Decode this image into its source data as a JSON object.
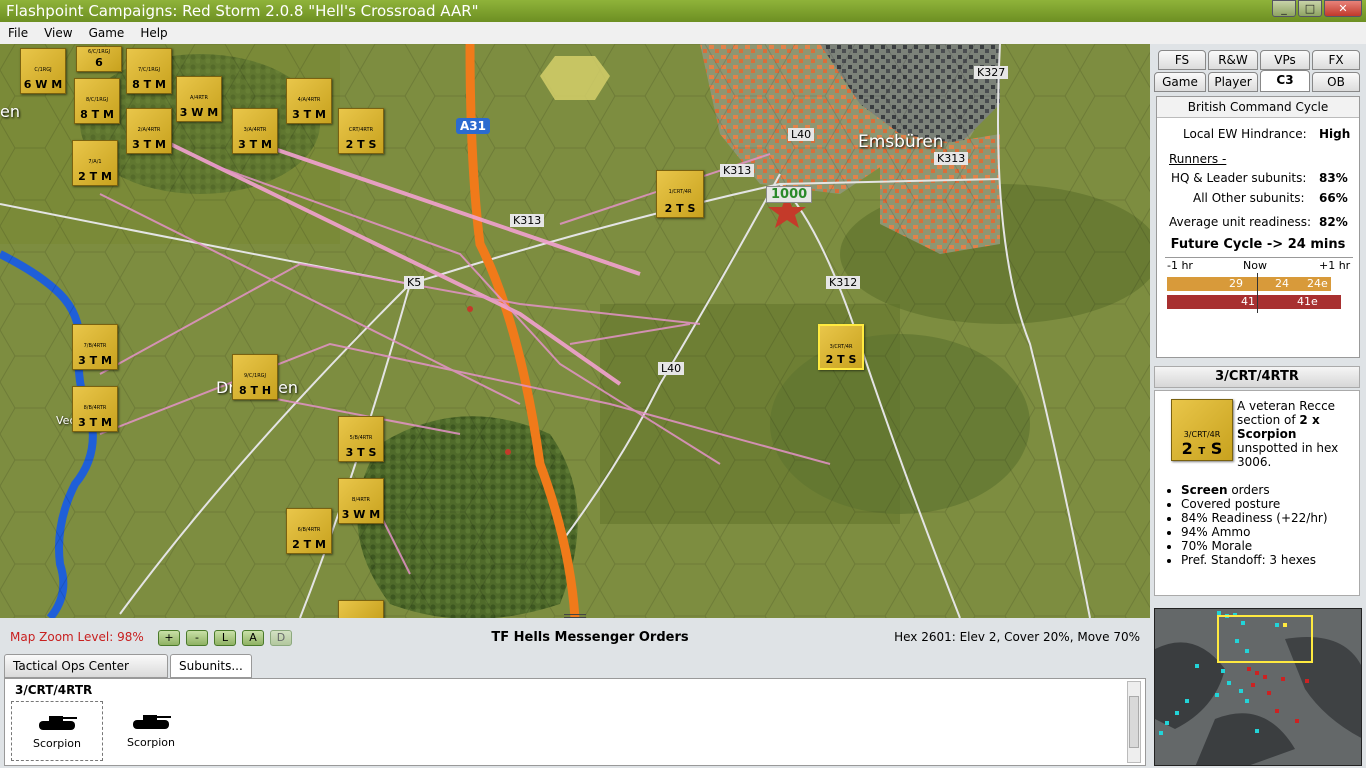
{
  "window": {
    "title": "Flashpoint Campaigns: Red Storm  2.0.8  \"Hell's Crossroad AAR\"",
    "min": "_",
    "max": "□",
    "close": "✕"
  },
  "menu": [
    "File",
    "View",
    "Game",
    "Help"
  ],
  "map": {
    "towns": [
      "Emsbüren",
      "Dr",
      "en",
      "en",
      "Vec"
    ],
    "roads": [
      "A31",
      "K327",
      "L40",
      "K313",
      "K313",
      "K313",
      "K5",
      "K312",
      "L40"
    ],
    "objective": "1000",
    "units": [
      {
        "id": "C/1RGJ",
        "str": "6",
        "t": "W",
        "s": "M"
      },
      {
        "id": "6/C/1RGJ",
        "str": "6",
        "t": "",
        "s": ""
      },
      {
        "id": "7/C/1RGJ",
        "str": "8",
        "t": "T",
        "s": "M"
      },
      {
        "id": "8/C/1RGJ",
        "str": "8",
        "t": "T",
        "s": "M"
      },
      {
        "id": "A/4RTR",
        "str": "3",
        "t": "W",
        "s": "M"
      },
      {
        "id": "4/A/4RTR",
        "str": "3",
        "t": "T",
        "s": "M"
      },
      {
        "id": "2/A/4RTR",
        "str": "3",
        "t": "T",
        "s": "M"
      },
      {
        "id": "3/A/4RTR",
        "str": "3",
        "t": "T",
        "s": "M"
      },
      {
        "id": "CRT/4RTR",
        "str": "2",
        "t": "T",
        "s": "S"
      },
      {
        "id": "7/A/1",
        "str": "2",
        "t": "T",
        "s": "M"
      },
      {
        "id": "1/CRT/4R",
        "str": "2",
        "t": "T",
        "s": "S"
      },
      {
        "id": "3/CRT/4R",
        "str": "2",
        "t": "T",
        "s": "S"
      },
      {
        "id": "7/B/4RTR",
        "str": "3",
        "t": "T",
        "s": "M"
      },
      {
        "id": "8/B/4RTR",
        "str": "3",
        "t": "T",
        "s": "M"
      },
      {
        "id": "9/C/1RGJ",
        "str": "8",
        "t": "T",
        "s": "H"
      },
      {
        "id": "5/B/4RTR",
        "str": "3",
        "t": "T",
        "s": "S"
      },
      {
        "id": "B/4RTR",
        "str": "3",
        "t": "W",
        "s": "M"
      },
      {
        "id": "6/B/4RTR",
        "str": "2",
        "t": "T",
        "s": "M"
      }
    ]
  },
  "tabs": {
    "row1": [
      "FS",
      "R&W",
      "VPs",
      "FX"
    ],
    "row2": [
      "Game",
      "Player",
      "C3",
      "OB"
    ],
    "active": "C3"
  },
  "c3": {
    "header": "British Command Cycle",
    "ew_label": "Local EW Hindrance:",
    "ew_value": "High",
    "runners": "Runners -",
    "hq_label": "HQ & Leader subunits:",
    "hq_value": "83%",
    "other_label": "All Other subunits:",
    "other_value": "66%",
    "ready_label": "Average unit readiness:",
    "ready_value": "82%",
    "future": "Future Cycle -> 24 mins",
    "t_minus": "-1 hr",
    "t_now": "Now",
    "t_plus": "+1 hr",
    "orange": [
      "29",
      "24",
      "24e"
    ],
    "red": [
      "41",
      "41e"
    ]
  },
  "unit": {
    "title": "3/CRT/4RTR",
    "counter": {
      "label": "3/CRT/4R",
      "str": "2",
      "t": "T",
      "s": "S"
    },
    "desc1": "A veteran Recce",
    "desc2": "section of ",
    "desc_bold": "2 x",
    "desc3": "Scorpion",
    "desc4": "unspotted in hex",
    "desc5": "3006.",
    "bullets": [
      {
        "bold": "Screen",
        "text": " orders"
      },
      {
        "bold": "",
        "text": "Covered posture"
      },
      {
        "bold": "",
        "text": "84% Readiness (+22/hr)"
      },
      {
        "bold": "",
        "text": "94% Ammo"
      },
      {
        "bold": "",
        "text": "70% Morale"
      },
      {
        "bold": "",
        "text": "Pref. Standoff: 3 hexes"
      }
    ]
  },
  "status": {
    "zoom": "Map Zoom Level: 98%",
    "zoom_buttons": [
      "+",
      "-",
      "L",
      "A",
      "D"
    ],
    "orders": "TF Hells Messenger Orders",
    "hex": "Hex 2601: Elev 2, Cover 20%, Move 70%"
  },
  "bottom": {
    "tabs": [
      "Tactical Ops Center Diary",
      "Subunits..."
    ],
    "unit": "3/CRT/4RTR",
    "subunits": [
      "Scorpion",
      "Scorpion"
    ]
  },
  "colors": {
    "title": "#7aa02d",
    "blue_units": "#22d4d8",
    "red_units": "#cc2222",
    "unit_yellow": "#e2bd3c"
  }
}
